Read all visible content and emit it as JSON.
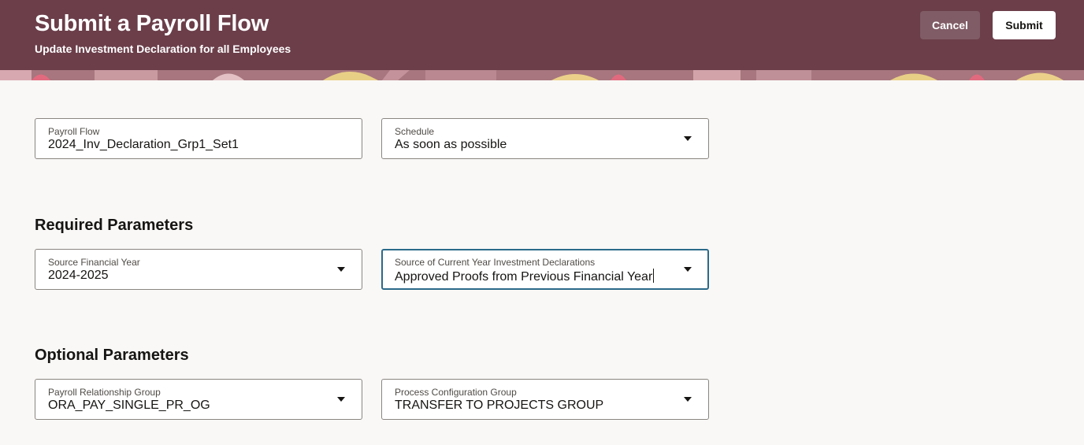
{
  "header": {
    "title": "Submit a Payroll Flow",
    "subtitle": "Update Investment Declaration for all Employees",
    "cancel_label": "Cancel",
    "submit_label": "Submit",
    "background_color": "#6b3e4a"
  },
  "basic": {
    "payroll_flow": {
      "label": "Payroll Flow",
      "value": "2024_Inv_Declaration_Grp1_Set1"
    },
    "schedule": {
      "label": "Schedule",
      "value": "As soon as possible"
    }
  },
  "required": {
    "title": "Required Parameters",
    "source_financial_year": {
      "label": "Source Financial Year",
      "value": "2024-2025"
    },
    "source_declarations": {
      "label": "Source of Current Year Investment Declarations",
      "value": "Approved Proofs from Previous Financial Year"
    }
  },
  "optional": {
    "title": "Optional Parameters",
    "payroll_relationship_group": {
      "label": "Payroll Relationship Group",
      "value": "ORA_PAY_SINGLE_PR_OG"
    },
    "process_configuration_group": {
      "label": "Process Configuration Group",
      "value": "TRANSFER TO PROJECTS GROUP"
    }
  },
  "icons": {
    "dropdown": "chevron-down-icon"
  },
  "colors": {
    "focus_border": "#2b6a8a",
    "page_background": "#f9f8f6"
  }
}
